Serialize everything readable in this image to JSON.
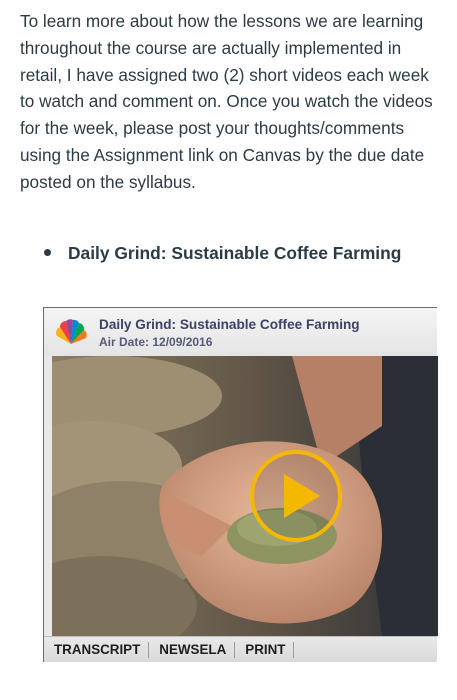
{
  "intro_text": "To learn more about how the lessons we are learning throughout the course are actually implemented in retail, I have assigned two (2) short videos each week to watch and comment on. Once you watch the videos for the week, please post your thoughts/comments using the Assignment link on Canvas by the due date posted on the syllabus.",
  "video_list": [
    {
      "label": "Daily Grind: Sustainable Coffee Farming"
    }
  ],
  "player": {
    "title": "Daily Grind: Sustainable Coffee Farming",
    "air_date": "Air Date: 12/09/2016",
    "logo_icon": "nbc-peacock-icon",
    "play_icon": "play-icon",
    "accent_color": "#f5b800",
    "toolbar": [
      "TRANSCRIPT",
      "NEWSELA",
      "PRINT"
    ]
  }
}
